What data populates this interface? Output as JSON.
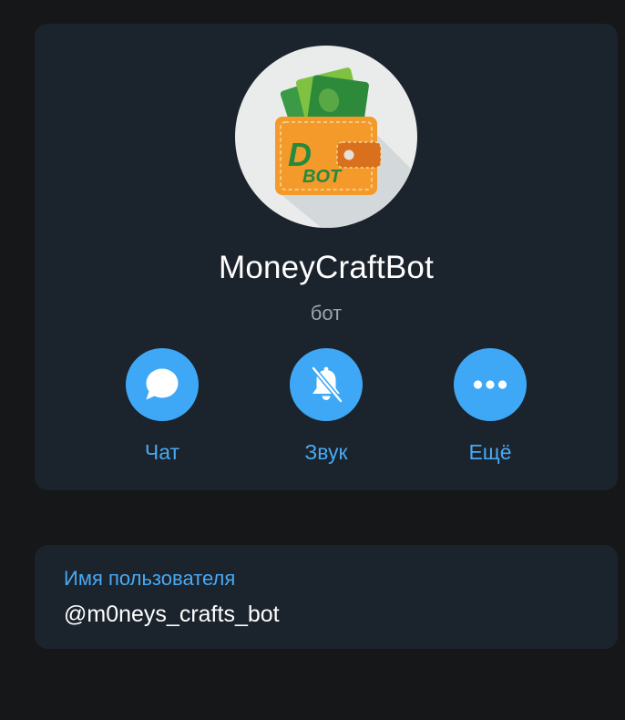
{
  "profile": {
    "name": "MoneyCraftBot",
    "subtitle": "бот",
    "avatar_text": "DBOT"
  },
  "actions": [
    {
      "label": "Чат",
      "icon": "chat-bubble-icon"
    },
    {
      "label": "Звук",
      "icon": "bell-muted-icon"
    },
    {
      "label": "Ещё",
      "icon": "more-dots-icon"
    }
  ],
  "username": {
    "label": "Имя пользователя",
    "value": "@m0neys_crafts_bot"
  },
  "colors": {
    "background": "#151718",
    "card": "#1b232c",
    "accent": "#3ea8f6",
    "text": "#ffffff",
    "muted": "#9aa5ae"
  }
}
